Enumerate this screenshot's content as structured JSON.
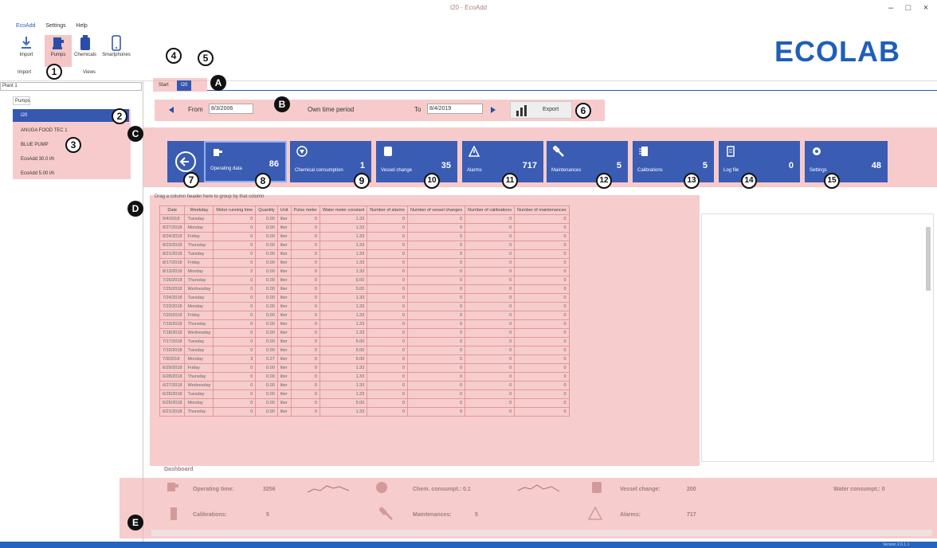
{
  "window": {
    "title": "I20 - EcoAdd",
    "minimize": "–",
    "maximize": "□",
    "close": "×"
  },
  "menu": [
    {
      "label": "EcoAdd"
    },
    {
      "label": "Settings"
    },
    {
      "label": "Help"
    }
  ],
  "ribbon": {
    "buttons": [
      {
        "label": "Import",
        "icon": "download-icon"
      },
      {
        "label": "Pumps",
        "icon": "pump-icon"
      },
      {
        "label": "Chemicals",
        "icon": "canister-icon"
      },
      {
        "label": "Smartphones",
        "icon": "smartphone-icon"
      }
    ],
    "groups": [
      {
        "label": "Import"
      },
      {
        "label": "Views"
      }
    ]
  },
  "logo": "ECOLAB",
  "sidebar": {
    "plant": "Plant 1",
    "tab": "Pumps",
    "selected": "I20",
    "items": [
      {
        "label": "ANUGA FOOD TEC 1"
      },
      {
        "label": "BLUE PUMP"
      },
      {
        "label": "EcoAdd 30.0 l/h"
      },
      {
        "label": "EcoAdd 5.00 l/h"
      }
    ]
  },
  "doc_tabs": [
    {
      "label": "Start"
    },
    {
      "label": "I20"
    }
  ],
  "filter": {
    "from_label": "From",
    "from_value": "8/3/2006",
    "period": "Own time period",
    "to_label": "To",
    "to_value": "8/4/2019",
    "export": "Export"
  },
  "tiles": [
    {
      "label": "Operating data",
      "count": "86"
    },
    {
      "label": "Chemical consumption",
      "count": "1"
    },
    {
      "label": "Vessel change",
      "count": "35"
    },
    {
      "label": "Alarms",
      "count": "717"
    },
    {
      "label": "Maintenances",
      "count": "5"
    },
    {
      "label": "Calibrations",
      "count": "5"
    },
    {
      "label": "Log file",
      "count": "0"
    },
    {
      "label": "Settings",
      "count": "48"
    }
  ],
  "grid": {
    "group_hint": "Drag a column header here to group by that column",
    "columns": [
      "Date",
      "Weekday",
      "Motor running time",
      "Quantity",
      "Unit",
      "Pulse meter",
      "Water meter constant",
      "Number of alarms",
      "Number of vessel changes",
      "Number of calibrations",
      "Number of maintenances"
    ],
    "rows": [
      [
        "9/4/2018",
        "Tuesday",
        "0",
        "0.00",
        "liter",
        "0",
        "1.33",
        "0",
        "0",
        "0",
        "0"
      ],
      [
        "8/27/2018",
        "Monday",
        "0",
        "0.00",
        "liter",
        "0",
        "1.33",
        "0",
        "0",
        "0",
        "0"
      ],
      [
        "8/24/2018",
        "Friday",
        "0",
        "0.00",
        "liter",
        "0",
        "1.33",
        "0",
        "0",
        "0",
        "0"
      ],
      [
        "8/23/2018",
        "Thursday",
        "0",
        "0.00",
        "liter",
        "0",
        "1.33",
        "0",
        "0",
        "0",
        "0"
      ],
      [
        "8/21/2018",
        "Tuesday",
        "0",
        "0.00",
        "liter",
        "0",
        "1.33",
        "0",
        "0",
        "0",
        "0"
      ],
      [
        "8/17/2018",
        "Friday",
        "0",
        "0.00",
        "liter",
        "0",
        "1.33",
        "0",
        "0",
        "0",
        "0"
      ],
      [
        "8/13/2018",
        "Monday",
        "2",
        "0.00",
        "liter",
        "0",
        "1.33",
        "0",
        "0",
        "0",
        "0"
      ],
      [
        "7/26/2018",
        "Thursday",
        "0",
        "0.00",
        "liter",
        "0",
        "5.00",
        "0",
        "0",
        "0",
        "0"
      ],
      [
        "7/25/2018",
        "Wednesday",
        "0",
        "0.00",
        "liter",
        "0",
        "5.00",
        "0",
        "0",
        "0",
        "0"
      ],
      [
        "7/24/2018",
        "Tuesday",
        "0",
        "0.00",
        "liter",
        "0",
        "1.33",
        "0",
        "0",
        "0",
        "0"
      ],
      [
        "7/23/2018",
        "Monday",
        "0",
        "0.00",
        "liter",
        "0",
        "1.33",
        "0",
        "0",
        "0",
        "0"
      ],
      [
        "7/20/2018",
        "Friday",
        "0",
        "0.00",
        "liter",
        "0",
        "1.33",
        "0",
        "0",
        "0",
        "0"
      ],
      [
        "7/19/2018",
        "Thursday",
        "0",
        "0.00",
        "liter",
        "0",
        "1.33",
        "0",
        "0",
        "0",
        "0"
      ],
      [
        "7/18/2018",
        "Wednesday",
        "0",
        "0.00",
        "liter",
        "0",
        "1.33",
        "0",
        "0",
        "0",
        "0"
      ],
      [
        "7/17/2018",
        "Tuesday",
        "0",
        "0.00",
        "liter",
        "0",
        "5.00",
        "0",
        "0",
        "0",
        "0"
      ],
      [
        "7/10/2018",
        "Tuesday",
        "0",
        "0.00",
        "liter",
        "0",
        "5.00",
        "0",
        "0",
        "0",
        "0"
      ],
      [
        "7/9/2018",
        "Monday",
        "3",
        "0.27",
        "liter",
        "0",
        "5.00",
        "0",
        "0",
        "0",
        "0"
      ],
      [
        "6/29/2018",
        "Friday",
        "0",
        "0.00",
        "liter",
        "0",
        "1.33",
        "0",
        "0",
        "0",
        "0"
      ],
      [
        "6/28/2018",
        "Thursday",
        "0",
        "0.00",
        "liter",
        "0",
        "1.33",
        "0",
        "0",
        "0",
        "0"
      ],
      [
        "6/27/2018",
        "Wednesday",
        "0",
        "0.00",
        "liter",
        "0",
        "1.33",
        "0",
        "0",
        "0",
        "0"
      ],
      [
        "6/26/2018",
        "Tuesday",
        "0",
        "0.00",
        "liter",
        "0",
        "1.33",
        "0",
        "0",
        "0",
        "0"
      ],
      [
        "6/25/2018",
        "Monday",
        "0",
        "0.00",
        "liter",
        "0",
        "5.00",
        "0",
        "0",
        "0",
        "0"
      ],
      [
        "6/21/2018",
        "Thursday",
        "0",
        "0.00",
        "liter",
        "0",
        "1.33",
        "0",
        "0",
        "0",
        "0"
      ]
    ]
  },
  "dashboard": {
    "title": "Dashboard",
    "operating_label": "Operating time:",
    "operating_value": "3256",
    "chem_label": "Chem. consumpt.: 0.1",
    "vessel_label": "Vessel change:",
    "vessel_value": "200",
    "water_label": "Water consumpt.: 0",
    "calib_label": "Calibrations:",
    "calib_value": "5",
    "maint_label": "Maintenances:",
    "maint_value": "5",
    "alarms_label": "Alarms:",
    "alarms_value": "717"
  },
  "callouts": [
    "1",
    "2",
    "3",
    "4",
    "5",
    "6",
    "7",
    "8",
    "9",
    "10",
    "11",
    "12",
    "13",
    "14",
    "15"
  ],
  "letters": [
    "A",
    "B",
    "C",
    "D",
    "E"
  ],
  "status": {
    "version": "Version 2.6.1.1"
  }
}
